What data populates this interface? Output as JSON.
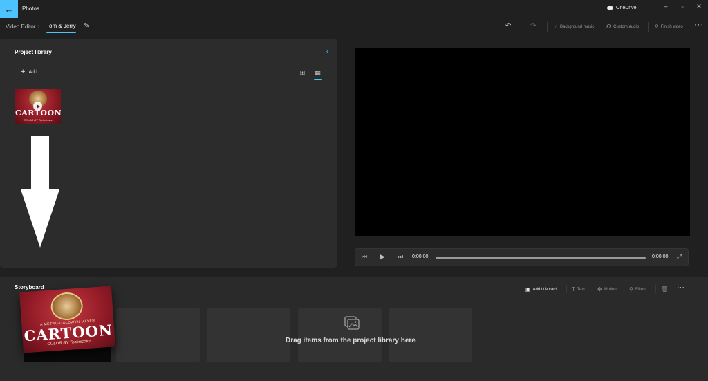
{
  "titlebar": {
    "app_title": "Photos",
    "onedrive_label": "OneDrive",
    "back_icon": "back-arrow-icon",
    "minimize": "–",
    "restore": "▫",
    "close": "✕"
  },
  "header": {
    "breadcrumb_root": "Video Editor",
    "breadcrumb_separator": "›",
    "breadcrumb_current": "Tom & Jerry",
    "undo": "↶",
    "redo": "↷",
    "background_music": "Background music",
    "custom_audio": "Custom audio",
    "finish_video": "Finish video",
    "more": "···"
  },
  "library": {
    "title": "Project library",
    "add_label": "Add",
    "thumbnail": {
      "logo_text": "CARTOON",
      "sub_text": "COLOR BY Technicolor"
    }
  },
  "player": {
    "current_time": "0:00.00",
    "total_time": "0:00.00",
    "progress": 0
  },
  "storyboard": {
    "title": "Storyboard",
    "add_title_card": "Add title card",
    "text": "Text",
    "motion": "Motion",
    "filters": "Filters",
    "more": "···",
    "drop_hint": "Drag items from the project library here",
    "dragging_card": {
      "tagline": "A METRO-GOLDWYN-MAYER",
      "logo_text": "CARTOON",
      "sub_text": "COLOR BY Technicolor"
    }
  },
  "colors": {
    "accent": "#4cc2ff",
    "background": "#202020",
    "panel": "#2c2c2c"
  }
}
